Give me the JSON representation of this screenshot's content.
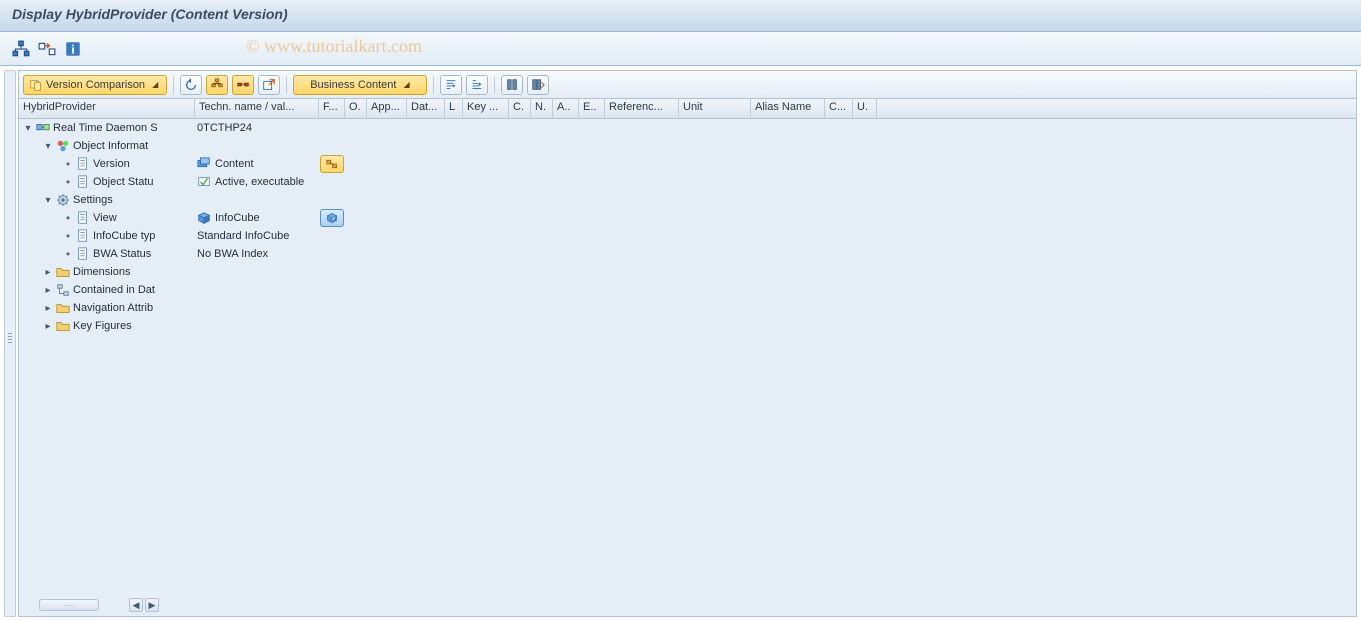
{
  "title": "Display HybridProvider (Content Version)",
  "watermark": "© www.tutorialkart.com",
  "subToolbar": {
    "versionComparison": "Version Comparison",
    "businessContent": "Business Content"
  },
  "columns": [
    {
      "label": "HybridProvider",
      "w": 176
    },
    {
      "label": "Techn. name / val...",
      "w": 124
    },
    {
      "label": "F...",
      "w": 26
    },
    {
      "label": "O.",
      "w": 22
    },
    {
      "label": "App...",
      "w": 40
    },
    {
      "label": "Dat...",
      "w": 38
    },
    {
      "label": "L",
      "w": 18
    },
    {
      "label": "Key ...",
      "w": 46
    },
    {
      "label": "C.",
      "w": 22
    },
    {
      "label": "N.",
      "w": 22
    },
    {
      "label": "A..",
      "w": 26
    },
    {
      "label": "E..",
      "w": 26
    },
    {
      "label": "Referenc...",
      "w": 74
    },
    {
      "label": "Unit",
      "w": 72
    },
    {
      "label": "Alias Name",
      "w": 74
    },
    {
      "label": "C...",
      "w": 28
    },
    {
      "label": "U.",
      "w": 24
    }
  ],
  "tree": {
    "root": {
      "label": "Real Time Daemon S",
      "tech": "0TCTHP24"
    },
    "objInfo": {
      "label": "Object Informat"
    },
    "version": {
      "label": "Version",
      "value": "Content"
    },
    "objStatus": {
      "label": "Object Statu",
      "value": "Active, executable"
    },
    "settings": {
      "label": "Settings"
    },
    "view": {
      "label": "View",
      "value": "InfoCube"
    },
    "infocubeType": {
      "label": "InfoCube typ",
      "value": "Standard InfoCube"
    },
    "bwa": {
      "label": "BWA Status",
      "value": "No BWA Index"
    },
    "dimensions": {
      "label": "Dimensions"
    },
    "contained": {
      "label": "Contained in Dat"
    },
    "navAttr": {
      "label": "Navigation Attrib"
    },
    "keyFigures": {
      "label": "Key Figures"
    }
  }
}
